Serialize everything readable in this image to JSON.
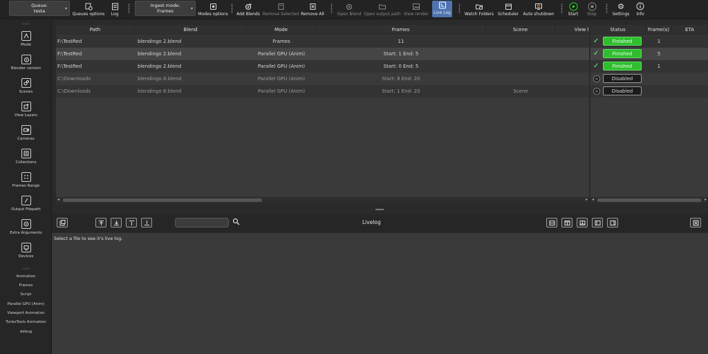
{
  "toolbar": {
    "queue_label": "Queue:",
    "queue_value": "testa",
    "queues_options": "Queues options",
    "log": "Log",
    "ingest_label": "Ingest mode:",
    "ingest_value": "Frames",
    "modes_options": "Modes options",
    "add_blends": "Add Blends",
    "remove_selected": "Remove Selected",
    "remove_all": "Remove All",
    "open_blend": "Open Blend",
    "open_output_path": "Open output path",
    "view_render": "View render",
    "live_log": "Live Log",
    "watch_folders": "Watch Folders",
    "scheduler": "Scheduler",
    "auto_shutdown": "Auto shutdown",
    "start": "Start",
    "stop": "Stop",
    "settings": "Settings",
    "info": "Info"
  },
  "sidebar": {
    "items": [
      {
        "label": "Mode"
      },
      {
        "label": "Blender version"
      },
      {
        "label": "Scenes"
      },
      {
        "label": "View Layers"
      },
      {
        "label": "Cameras"
      },
      {
        "label": "Collections"
      },
      {
        "label": "Frames Range"
      },
      {
        "label": "Output Filepath"
      },
      {
        "label": "Extra Arguments"
      },
      {
        "label": "Devices"
      }
    ],
    "presets": [
      "Animation",
      "Frames",
      "Script",
      "Parallel GPU (Anim)",
      "Viewport Animation",
      "TurboTools Animation",
      "debug"
    ]
  },
  "table": {
    "headers": [
      "Path",
      "Blend",
      "Mode",
      "Frames",
      "Scene",
      "View lay"
    ],
    "status_headers": [
      "Status",
      "Frame(s)",
      "ETA"
    ],
    "rows": [
      {
        "path": "F:\\TestRed",
        "blend": "blendingo 2.blend",
        "mode": "Frames",
        "frames": "11",
        "scene": "",
        "status": "Finished",
        "frame_count": "1",
        "eta": ""
      },
      {
        "path": "F:\\TestRed",
        "blend": "blendingo 2.blend",
        "mode": "Parallel GPU (Anim)",
        "frames": "Start: 1  End: 5",
        "scene": "",
        "status": "Finished",
        "frame_count": "5",
        "eta": ""
      },
      {
        "path": "F:\\TestRed",
        "blend": "blendingo 2.blend",
        "mode": "Parallel GPU (Anim)",
        "frames": "Start: 0  End: 5",
        "scene": "",
        "status": "Finished",
        "frame_count": "1",
        "eta": ""
      },
      {
        "path": "C:\\Downloads",
        "blend": "blendingo 8.blend",
        "mode": "Parallel GPU (Anim)",
        "frames": "Start: 8  End: 20",
        "scene": "",
        "status": "Disabled",
        "frame_count": "",
        "eta": ""
      },
      {
        "path": "C:\\Downloads",
        "blend": "blendingo 8.blend",
        "mode": "Parallel GPU (Anim)",
        "frames": "Start: 1  End: 20",
        "scene": "Scene",
        "status": "Disabled",
        "frame_count": "",
        "eta": ""
      }
    ]
  },
  "livelog": {
    "title": "Livelog",
    "search_value": "",
    "message": "Select a file to see it's live log."
  },
  "colors": {
    "accent": "#4f74b0",
    "finished": "#2fbd2f",
    "start_green": "#2fd62f"
  }
}
